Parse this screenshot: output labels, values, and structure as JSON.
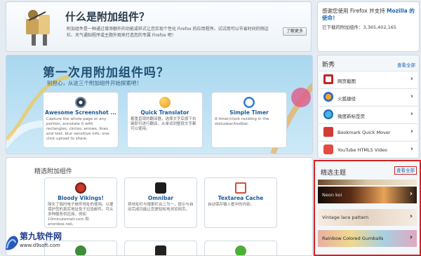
{
  "banner": {
    "title": "什么是附加组件？",
    "description": "附加组件是一种通过增添额外的功能或样式让您实现个性化 Firefox 的应用程序。试试用可以节省时间的侧边栏、天气通知程序或主题外观来打造您的专属 Firefox 吧！",
    "learn_more": "了解更多"
  },
  "stats": {
    "thanks_prefix": "感谢您使用 Firefox 并支持 ",
    "mission": "Mozilla 的使命！",
    "downloads": "已下载的附加组件：3,365,402,165"
  },
  "hero": {
    "title": "第一次用附加组件吗？",
    "subtitle": "别担心，从这三个附加组件开始探索吧！",
    "cards": [
      {
        "name": "Awesome Screenshot ...",
        "desc": "Capture the whole page or any portion, annotate it with rectangles, circles, arrows, lines and text, blur sensitive info, one-click upload to share."
      },
      {
        "name": "Quick Translator",
        "desc": "着重直观的翻译器，选择文字后按下右键即可进行翻译，从单词到整段文字都可以使用。"
      },
      {
        "name": "Simple Timer",
        "desc": "A timer/clock residing in the statusbar/toolbar."
      }
    ]
  },
  "featured": {
    "title": "精选附加组件",
    "cards": [
      {
        "name": "Bloody Vikings!",
        "desc": "简化了临时电子邮件地址的使用。以便保护您的真实地址免于垃圾邮件。可从多种服务供应商，例如 10minutemail.com 和 anonbox.net。"
      },
      {
        "name": "Omnibar",
        "desc": "将地址栏与搜索栏合二为一，提示与自动完成功能让您更轻松地浏览网页。"
      },
      {
        "name": "Textarea Cache",
        "desc": "自动保存输入框中的内容。"
      }
    ]
  },
  "new_panel": {
    "title": "新秀",
    "see_all": "查看全部",
    "items": [
      {
        "label": "网页截图",
        "icon": "crop-icon",
        "color": "#c0262b"
      },
      {
        "label": "火狐捷径",
        "icon": "shortcut-icon",
        "color": "#ffffff"
      },
      {
        "label": "微度新标签页",
        "icon": "newtab-icon",
        "color": "#ffffff"
      },
      {
        "label": "Bookmark Quick Mover",
        "icon": "bookmark-icon",
        "color": "#d23b36"
      },
      {
        "label": "YouTube HTML5 Video",
        "icon": "youtube-icon",
        "color": "#e24b3f"
      }
    ]
  },
  "themes_panel": {
    "title": "精选主题",
    "see_all": "查看全部",
    "items": [
      {
        "label": "Neon koi",
        "bg": "#2a1a12",
        "text": "#f0e6d8"
      },
      {
        "label": "Vintage lace pattern",
        "bg": "#efe5da",
        "text": "#333333"
      },
      {
        "label": "Rainbow Colored Gumballs",
        "bg": "#c8a890",
        "text": "#222222"
      }
    ]
  },
  "watermark": {
    "name": "第九软件网",
    "url": "www.d9soft.com"
  },
  "colors": {
    "accent": "#1a66b3",
    "highlight_border": "#d62020"
  }
}
